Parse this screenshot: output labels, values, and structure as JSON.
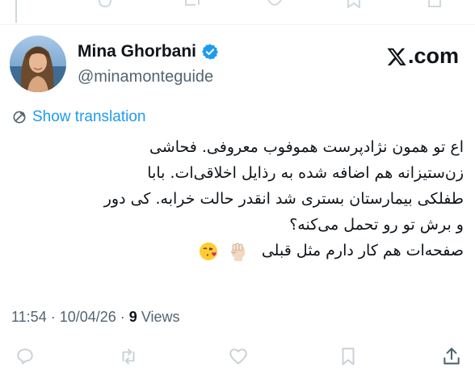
{
  "author": {
    "display_name": "Mina Ghorbani",
    "handle": "@minamonteguide",
    "verified": true
  },
  "brand": {
    "logo_text": ".com",
    "logo_icon": "x-logo-icon"
  },
  "translate": {
    "label": "Show translation"
  },
  "tweet": {
    "lines": [
      "اع تو همون نژادپرست هموفوب معروفی. فحاشی",
      "زن‌ستیزانه هم اضافه شده به رذایل اخلاقی‌ات. بابا",
      "طفلکی بیمارستان بستری شد انقدر حالت خرابه. کی دور",
      "و برش تو رو تحمل می‌کنه؟",
      "صفحه‌ات هم کار دارم مثل قبلی"
    ],
    "emojis": [
      "raised-fist-emoji",
      "face-blowing-kiss-emoji"
    ]
  },
  "meta": {
    "time": "11:54",
    "separator": " · ",
    "date": "10/04/26",
    "views_count": "9",
    "views_label": "Views"
  },
  "actions": [
    "reply-icon",
    "retweet-icon",
    "like-icon",
    "bookmark-icon",
    "share-icon"
  ],
  "colors": {
    "accent": "#1d9bf0",
    "text": "#0f1419",
    "muted": "#536471",
    "icon": "#c9d1d6"
  }
}
